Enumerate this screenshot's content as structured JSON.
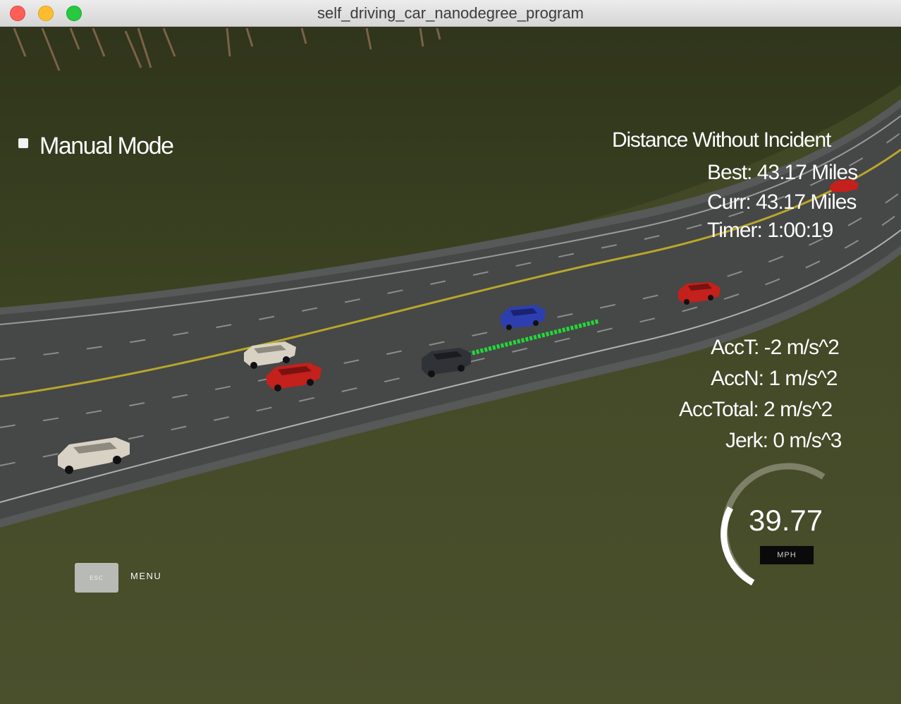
{
  "window": {
    "title": "self_driving_car_nanodegree_program"
  },
  "hud": {
    "mode_label": "Manual Mode",
    "distance_title": "Distance Without Incident",
    "best": "Best: 43.17 Miles",
    "curr": "Curr: 43.17 Miles",
    "timer": "Timer: 1:00:19",
    "acc_t": "AccT: -2 m/s^2",
    "acc_n": "AccN: 1 m/s^2",
    "acc_total": "AccTotal: 2 m/s^2",
    "jerk": "Jerk: 0 m/s^3",
    "speed": "39.77",
    "speed_unit": "MPH",
    "esc_key": "ESC",
    "menu_label": "MENU"
  },
  "colors": {
    "grass": "#3d4322",
    "road": "#4a4a4a",
    "center_line": "#b8a72a",
    "planned_path": "#22d83a"
  },
  "vehicles": [
    {
      "name": "ego-car",
      "color": "#2f3236"
    },
    {
      "name": "blue-car",
      "color": "#2d3fb0"
    },
    {
      "name": "red-car-near",
      "color": "#c4201c"
    },
    {
      "name": "white-car-near",
      "color": "#d8d2c4"
    },
    {
      "name": "white-car-far-left",
      "color": "#d8d2c4"
    },
    {
      "name": "red-car-right",
      "color": "#c4201c"
    },
    {
      "name": "red-car-distant",
      "color": "#c4201c"
    }
  ]
}
